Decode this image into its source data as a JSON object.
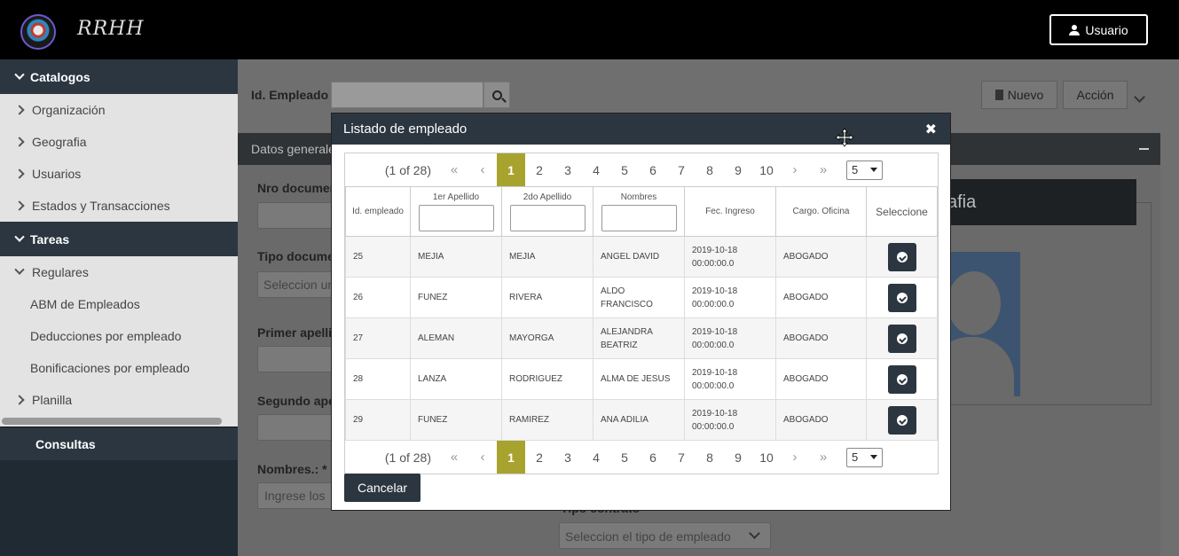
{
  "topbar": {
    "brand": "RRHH",
    "user_button": "Usuario"
  },
  "sidebar": {
    "catalogos_label": "Catalogos",
    "catalogos_items": [
      "Organización",
      "Geografia",
      "Usuarios",
      "Estados y Transacciones"
    ],
    "tareas_label": "Tareas",
    "regulares_label": "Regulares",
    "regulares_items": [
      "ABM de Empleados",
      "Deducciones por empleado",
      "Bonificaciones por empleado"
    ],
    "planilla_label": "Planilla",
    "consultas_label": "Consultas"
  },
  "toolbar": {
    "id_label": "Id. Empleado",
    "nuevo_label": "Nuevo",
    "accion_label": "Acción"
  },
  "form": {
    "panel_title": "Datos generales",
    "nro_documento_label": "Nro documento",
    "tipo_documento_label": "Tipo documento",
    "tipo_documento_placeholder": "Seleccion un",
    "primer_apellido_label": "Primer apellido",
    "segundo_apellido_label": "Segundo apellido",
    "nombres_label": "Nombres.: *",
    "nombres_placeholder": "Ingrese los",
    "tipo_contrato_label": "Tipo contrato",
    "tipo_contrato_placeholder": "Seleccion el tipo de empleado",
    "fotografia_title": "afia"
  },
  "modal": {
    "title": "Listado de empleado",
    "pager": {
      "count": "(1 of 28)",
      "pages": [
        "1",
        "2",
        "3",
        "4",
        "5",
        "6",
        "7",
        "8",
        "9",
        "10"
      ],
      "active_page": "1",
      "rows_per_page": "5",
      "first": "«",
      "prev": "‹",
      "next": "›",
      "last": "»"
    },
    "columns": [
      "Id. empleado",
      "1er Apellido",
      "2do Apellido",
      "Nombres",
      "Fec. Ingreso",
      "Cargo. Oficina",
      "Seleccione"
    ],
    "rows": [
      [
        "25",
        "MEJIA",
        "MEJIA",
        "ANGEL DAVID",
        "2019-10-18 00:00:00.0",
        "ABOGADO"
      ],
      [
        "26",
        "FUNEZ",
        "RIVERA",
        "ALDO FRANCISCO",
        "2019-10-18 00:00:00.0",
        "ABOGADO"
      ],
      [
        "27",
        "ALEMAN",
        "MAYORGA",
        "ALEJANDRA BEATRIZ",
        "2019-10-18 00:00:00.0",
        "ABOGADO"
      ],
      [
        "28",
        "LANZA",
        "RODRIGUEZ",
        "ALMA DE JESUS",
        "2019-10-18 00:00:00.0",
        "ABOGADO"
      ],
      [
        "29",
        "FUNEZ",
        "RAMIREZ",
        "ANA ADILIA",
        "2019-10-18 00:00:00.0",
        "ABOGADO"
      ]
    ],
    "cancel_label": "Cancelar"
  }
}
